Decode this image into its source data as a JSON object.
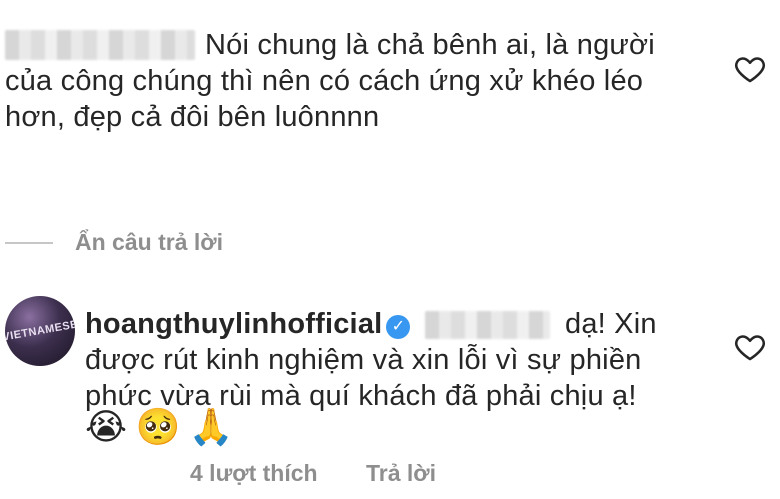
{
  "comment1": {
    "text_line1": "Nói chung là chả bênh ai, là người",
    "text_line2": "của công chúng thì nên có cách ứng xử khéo léo",
    "text_line3": "hơn, đẹp cả đôi bên luônnnn"
  },
  "hide_replies": "Ẩn câu trả lời",
  "reply": {
    "username": "hoangthuylinhofficial",
    "avatar_text": "VIETNAMESE",
    "text_line1": "dạ! Xin",
    "text_line2": "được rút kinh nghiệm và xin lỗi vì sự phiền",
    "text_line3": "phức vừa rùi mà quí khách đã phải chịu ạ!",
    "emojis": [
      "😭",
      "🥺",
      "🙏"
    ],
    "likes": "4 lượt thích",
    "reply_label": "Trả lời"
  },
  "colors": {
    "text": "#262626",
    "muted": "#8e8e8e",
    "verified": "#3897f0"
  }
}
